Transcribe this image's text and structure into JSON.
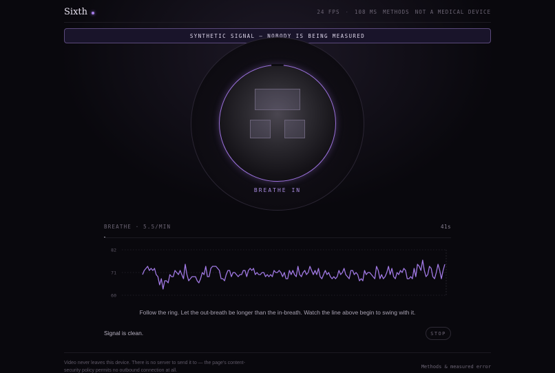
{
  "app": {
    "brand": "Sixth",
    "accent_color": "#a67de8"
  },
  "nav": {
    "fps": "24 FPS",
    "latency": "108 MS",
    "methods_label": "METHODS",
    "disclaimer": "NOT A MEDICAL DEVICE"
  },
  "banner": {
    "text": "SYNTHETIC SIGNAL — NOBODY IS BEING MEASURED",
    "border_color": "#5b4a7c"
  },
  "orb": {
    "label": "BREATHE IN",
    "ring_color": "#9c72dd"
  },
  "pace": {
    "label": "BREATHE · 5.5/MIN",
    "elapsed": "41s"
  },
  "chart_data": {
    "type": "line",
    "y_ticks": [
      "82",
      "71",
      "60"
    ],
    "ylim": [
      60,
      82
    ],
    "grid": true,
    "line_color": "#a27ae6",
    "series": [
      {
        "values": [
          70,
          72,
          73,
          74,
          72,
          73,
          72,
          73,
          70,
          69,
          65,
          68,
          63,
          67,
          67,
          66,
          70,
          69,
          69,
          72,
          71,
          70,
          72,
          70,
          68,
          75,
          70,
          67,
          68,
          69,
          69,
          69,
          67,
          66,
          68,
          71,
          70,
          74,
          69,
          69,
          73,
          74,
          74,
          74,
          73,
          72,
          68,
          68,
          67,
          70,
          72,
          72,
          69,
          71,
          71,
          70,
          69,
          70,
          70,
          72,
          72,
          69,
          72,
          73,
          72,
          73,
          70,
          71,
          70,
          70,
          71,
          71,
          69,
          70,
          69,
          70,
          69,
          72,
          71,
          71,
          72,
          71,
          69,
          71,
          68,
          68,
          72,
          70,
          72,
          70,
          69,
          74,
          70,
          69,
          71,
          72,
          70,
          71,
          74,
          72,
          70,
          72,
          70,
          73,
          69,
          68,
          70,
          72,
          70,
          71,
          69,
          68,
          69,
          68,
          69,
          72,
          70,
          71,
          73,
          70,
          69,
          68,
          72,
          72,
          70,
          71,
          70,
          67,
          68,
          67,
          72,
          70,
          71,
          71,
          70,
          69,
          68,
          74,
          72,
          68,
          70,
          68,
          69,
          71,
          74,
          70,
          73,
          69,
          68,
          71,
          70,
          72,
          71,
          73,
          72,
          68,
          68,
          69,
          68,
          73,
          69,
          75,
          74,
          72,
          77,
          72,
          69,
          70,
          74,
          73,
          69,
          68,
          71,
          75,
          72,
          68,
          72,
          75
        ]
      }
    ]
  },
  "instruction": "Follow the ring. Let the out-breath be longer than the in-breath. Watch the line above begin to swing with it.",
  "status": "Signal is clean.",
  "stop_label": "STOP",
  "footer": {
    "note": "Video never leaves this device. There is no server to send it to — the page's content-security policy permits no outbound connection at all.",
    "link": "Methods & measured error"
  }
}
